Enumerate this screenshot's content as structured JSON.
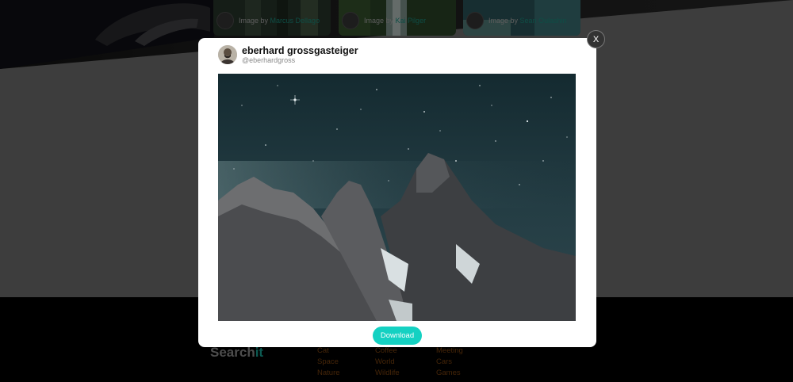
{
  "brand": {
    "name_main": "Search",
    "name_accent": "it",
    "accent_color": "#19b3a3"
  },
  "gallery": {
    "cards": [
      {
        "credit_prefix": "Image by",
        "author": "Marcus Dellago"
      },
      {
        "credit_prefix": "Image by",
        "author": "Kai Pilger"
      },
      {
        "credit_prefix": "Image by",
        "author": "Sean Oulashin"
      }
    ]
  },
  "modal": {
    "author_name": "eberhard grossgasteiger",
    "author_handle": "@eberhardgross",
    "photo_subject": "mountain-night-sky",
    "download_label": "Download",
    "close_label": "X",
    "download_color": "#14d1c2"
  },
  "footer": {
    "columns": [
      [
        "Cat",
        "Space",
        "Nature"
      ],
      [
        "Coffee",
        "World",
        "Wildlife"
      ],
      [
        "Meeting",
        "Cars",
        "Games"
      ]
    ],
    "link_color": "#8a4a10"
  }
}
